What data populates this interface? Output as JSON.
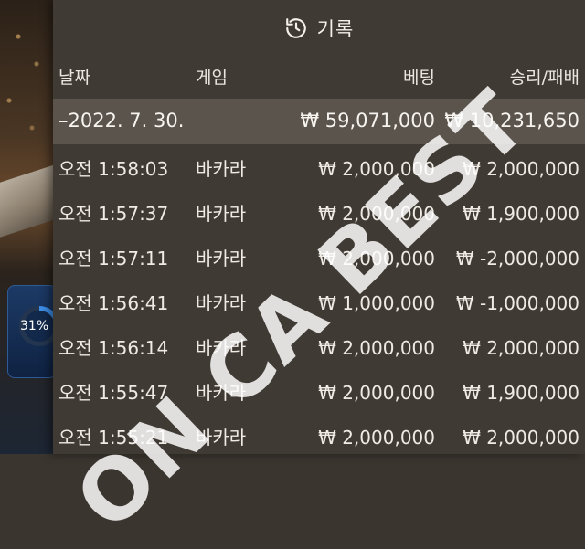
{
  "overlay": {
    "progress_percent": "31%",
    "progress_value": 31
  },
  "header": {
    "title": "기록",
    "icon": "history-icon"
  },
  "columns": {
    "date": "날짜",
    "game": "게임",
    "bet": "베팅",
    "win_loss": "승리/패배"
  },
  "summary": {
    "date": "–2022. 7. 30.",
    "bet": "₩ 59,071,000",
    "win_loss": "₩ 10,231,650"
  },
  "rows": [
    {
      "time": "오전 1:58:03",
      "game": "바카라",
      "bet": "₩ 2,000,000",
      "result": "₩ 2,000,000"
    },
    {
      "time": "오전 1:57:37",
      "game": "바카라",
      "bet": "₩ 2,000,000",
      "result": "₩ 1,900,000"
    },
    {
      "time": "오전 1:57:11",
      "game": "바카라",
      "bet": "₩ 2,000,000",
      "result": "₩ -2,000,000"
    },
    {
      "time": "오전 1:56:41",
      "game": "바카라",
      "bet": "₩ 1,000,000",
      "result": "₩ -1,000,000"
    },
    {
      "time": "오전 1:56:14",
      "game": "바카라",
      "bet": "₩ 2,000,000",
      "result": "₩ 2,000,000"
    },
    {
      "time": "오전 1:55:47",
      "game": "바카라",
      "bet": "₩ 2,000,000",
      "result": "₩ 1,900,000"
    },
    {
      "time": "오전 1:55:21",
      "game": "바카라",
      "bet": "₩ 2,000,000",
      "result": "₩ 2,000,000"
    }
  ],
  "watermark": "ON CA BEST",
  "colors": {
    "panel_bg": "#403a34",
    "summary_bg": "#5b544d",
    "progress_accent": "#3d8fe8"
  }
}
